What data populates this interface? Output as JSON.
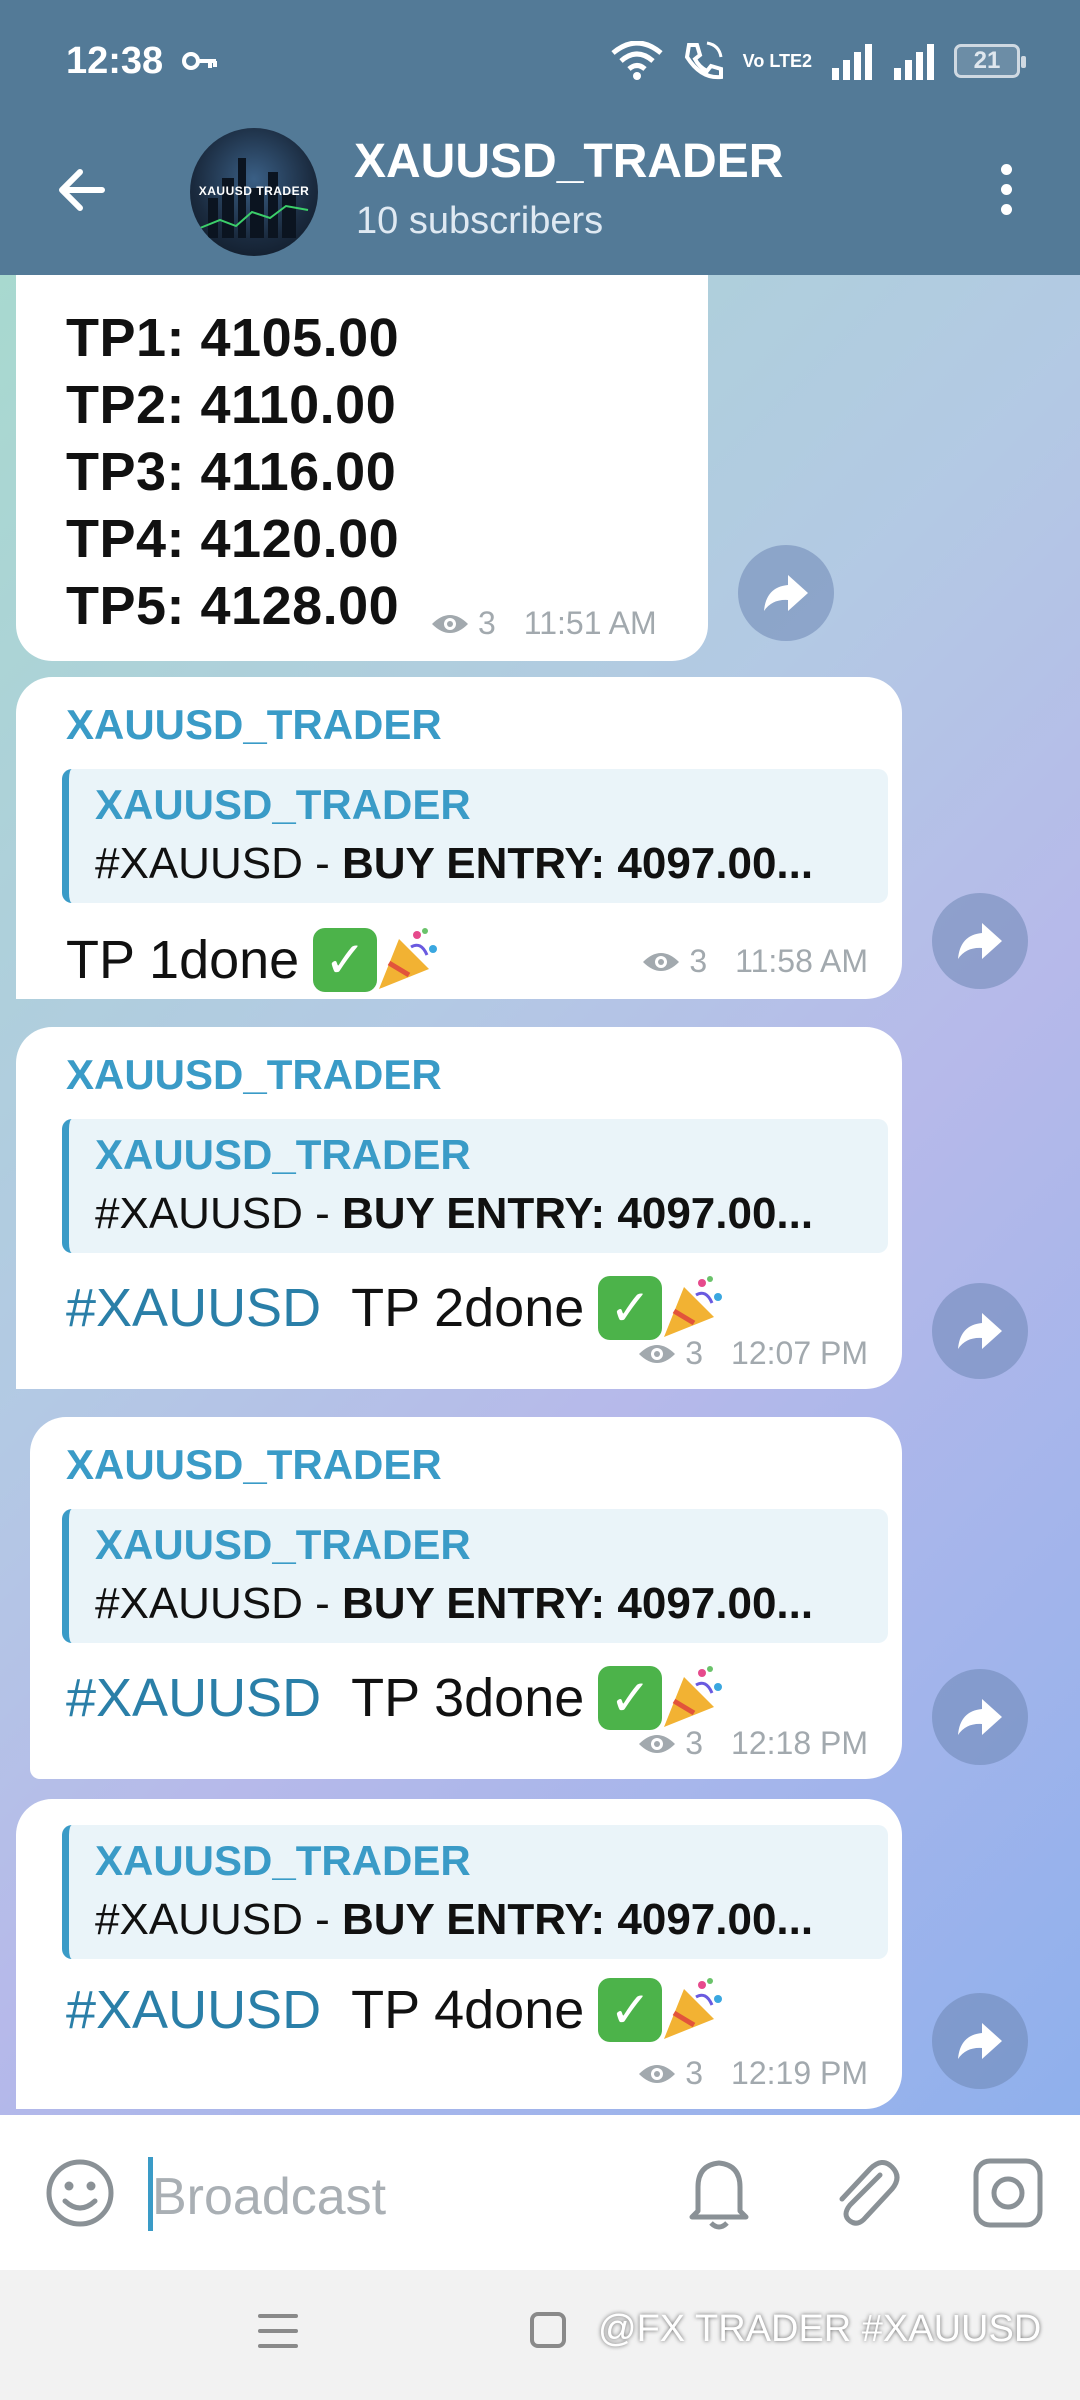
{
  "status_bar": {
    "time": "12:38",
    "network": "Vo LTE2",
    "battery": "21"
  },
  "header": {
    "title": "XAUUSD_TRADER",
    "subtitle": "10 subscribers",
    "avatar_text": "XAUUSD TRADER"
  },
  "messages": [
    {
      "lines": [
        "TP1: 4105.00",
        "TP2: 4110.00",
        "TP3: 4116.00",
        "TP4: 4120.00",
        "TP5: 4128.00"
      ],
      "views": "3",
      "time": "11:51 AM"
    },
    {
      "sender": "XAUUSD_TRADER",
      "quote_name": "XAUUSD_TRADER",
      "quote_pre": "#XAUUSD - ",
      "quote_bold": "BUY  ENTRY: 4097.00...",
      "tag": "",
      "text": "TP 1done",
      "views": "3",
      "time": "11:58 AM"
    },
    {
      "sender": "XAUUSD_TRADER",
      "quote_name": "XAUUSD_TRADER",
      "quote_pre": "#XAUUSD - ",
      "quote_bold": "BUY  ENTRY: 4097.00...",
      "tag": "#XAUUSD",
      "text": "TP 2done",
      "views": "3",
      "time": "12:07 PM"
    },
    {
      "sender": "XAUUSD_TRADER",
      "quote_name": "XAUUSD_TRADER",
      "quote_pre": "#XAUUSD - ",
      "quote_bold": "BUY  ENTRY: 4097.00...",
      "tag": "#XAUUSD",
      "text": "TP 3done",
      "views": "3",
      "time": "12:18 PM"
    },
    {
      "quote_name": "XAUUSD_TRADER",
      "quote_pre": "#XAUUSD - ",
      "quote_bold": "BUY  ENTRY: 4097.00...",
      "tag": "#XAUUSD",
      "text": "TP 4done",
      "views": "3",
      "time": "12:19 PM"
    }
  ],
  "input": {
    "placeholder": "Broadcast"
  },
  "watermark": "@FX TRADER #XAUUSD",
  "icons": {
    "back": "arrow-left-icon",
    "more": "more-vert-icon",
    "forward": "share-icon",
    "views": "eye-icon",
    "emoji": "smile-icon",
    "bell": "bell-icon",
    "attach": "paperclip-icon",
    "camera": "camera-icon",
    "check": "check-mark-emoji",
    "party": "party-popper-emoji"
  },
  "colors": {
    "header": "#537a97",
    "accent": "#3a9bc7",
    "hashtag": "#2a7fa8",
    "check": "#4cb34a"
  }
}
